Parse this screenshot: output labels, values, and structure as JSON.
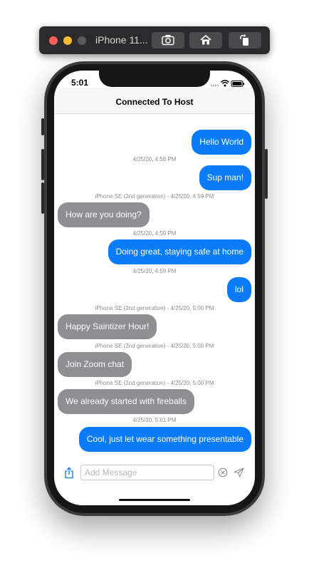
{
  "simulator": {
    "title": "iPhone 11...",
    "buttons": [
      "screenshot-icon",
      "home-icon",
      "rotate-icon"
    ],
    "colors": {
      "close": "#ff5f57",
      "minimize": "#febc2e",
      "zoom": "#5b5b5d"
    }
  },
  "status_bar": {
    "time": "5:01",
    "icons": [
      "signal-icon",
      "wifi-icon",
      "battery-icon"
    ]
  },
  "nav": {
    "title": "Connected To Host"
  },
  "messages": [
    {
      "direction": "outgoing",
      "text": "Hello World",
      "meta": "4/25/20, 4:58 PM"
    },
    {
      "direction": "outgoing",
      "text": "Sup man!",
      "meta": "iPhone SE (2nd generation) - 4/25/20, 4:59 PM"
    },
    {
      "direction": "incoming",
      "text": "How are you doing?",
      "meta": "4/25/20, 4:59 PM"
    },
    {
      "direction": "outgoing",
      "text": "Doing great, staying safe at home",
      "meta": "4/25/20, 4:59 PM"
    },
    {
      "direction": "outgoing",
      "text": "lol",
      "meta": "iPhone SE (2nd generation) - 4/25/20, 5:00 PM"
    },
    {
      "direction": "incoming",
      "text": "Happy Saintizer Hour!",
      "meta": "iPhone SE (2nd generation) - 4/25/20, 5:00 PM"
    },
    {
      "direction": "incoming",
      "text": "Join Zoom chat",
      "meta": "iPhone SE (2nd generation) - 4/25/20, 5:00 PM"
    },
    {
      "direction": "incoming",
      "text": "We already started with fireballs",
      "meta": "4/25/20, 5:01 PM"
    },
    {
      "direction": "outgoing",
      "text": "Cool, just let wear something presentable",
      "meta": ""
    }
  ],
  "composer": {
    "placeholder": "Add Message",
    "value": "",
    "icons": [
      "share-icon",
      "clear-icon",
      "send-icon"
    ]
  },
  "colors": {
    "outgoing_bubble": "#0a7cf7",
    "incoming_bubble": "#8e8e93",
    "accent": "#0a7cf7"
  }
}
